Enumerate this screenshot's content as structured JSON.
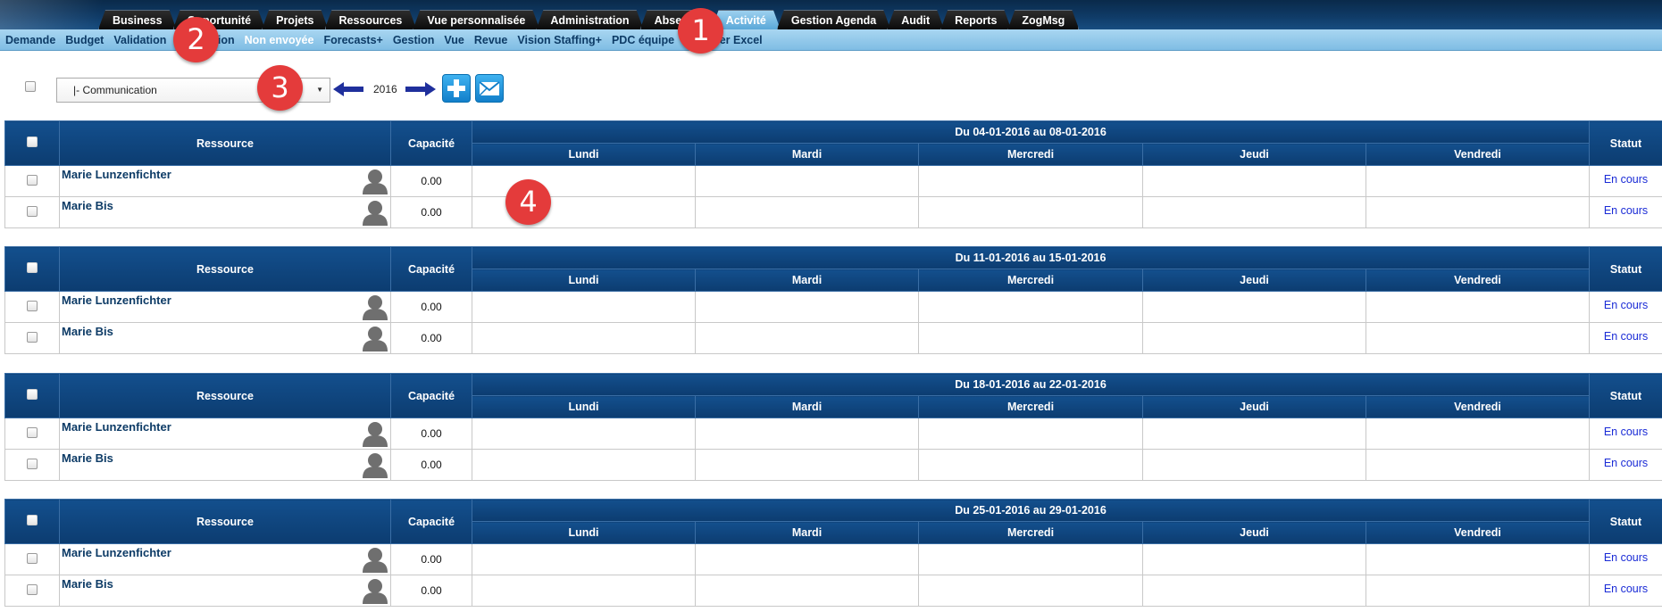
{
  "tabs": [
    {
      "label": "Business",
      "active": false
    },
    {
      "label": "Opportunité",
      "active": false
    },
    {
      "label": "Projets",
      "active": false
    },
    {
      "label": "Ressources",
      "active": false
    },
    {
      "label": "Vue personnalisée",
      "active": false
    },
    {
      "label": "Administration",
      "active": false
    },
    {
      "label": "Absence",
      "active": false
    },
    {
      "label": "Activité",
      "active": true
    },
    {
      "label": "Gestion Agenda",
      "active": false
    },
    {
      "label": "Audit",
      "active": false
    },
    {
      "label": "Reports",
      "active": false
    },
    {
      "label": "ZogMsg",
      "active": false
    }
  ],
  "submenu": [
    {
      "label": "Demande",
      "active": false
    },
    {
      "label": "Budget",
      "active": false
    },
    {
      "label": "Validation",
      "active": false
    },
    {
      "label": "Annulation",
      "active": false
    },
    {
      "label": "Non envoyée",
      "active": true
    },
    {
      "label": "Forecasts+",
      "active": false
    },
    {
      "label": "Gestion",
      "active": false
    },
    {
      "label": "Vue",
      "active": false
    },
    {
      "label": "Revue",
      "active": false
    },
    {
      "label": "Vision Staffing+",
      "active": false
    },
    {
      "label": "PDC équipe",
      "active": false
    },
    {
      "label": "Exporter Excel",
      "active": false
    }
  ],
  "toolbar": {
    "select_value": "|- Communication",
    "year": "2016",
    "prev_icon": "arrow-left-icon",
    "next_icon": "arrow-right-icon",
    "add_icon": "plus-icon",
    "mail_icon": "envelope-icon"
  },
  "table_headers": {
    "resource": "Ressource",
    "capacity": "Capacité",
    "days": [
      "Lundi",
      "Mardi",
      "Mercredi",
      "Jeudi",
      "Vendredi"
    ],
    "status": "Statut"
  },
  "weeks": [
    {
      "range": "Du 04-01-2016 au 08-01-2016",
      "rows": [
        {
          "name": "Marie Lunzenfichter",
          "capacity": "0.00",
          "status": "En cours"
        },
        {
          "name": "Marie Bis",
          "capacity": "0.00",
          "status": "En cours"
        }
      ]
    },
    {
      "range": "Du 11-01-2016 au 15-01-2016",
      "rows": [
        {
          "name": "Marie Lunzenfichter",
          "capacity": "0.00",
          "status": "En cours"
        },
        {
          "name": "Marie Bis",
          "capacity": "0.00",
          "status": "En cours"
        }
      ]
    },
    {
      "range": "Du 18-01-2016 au 22-01-2016",
      "rows": [
        {
          "name": "Marie Lunzenfichter",
          "capacity": "0.00",
          "status": "En cours"
        },
        {
          "name": "Marie Bis",
          "capacity": "0.00",
          "status": "En cours"
        }
      ]
    },
    {
      "range": "Du 25-01-2016 au 29-01-2016",
      "rows": [
        {
          "name": "Marie Lunzenfichter",
          "capacity": "0.00",
          "status": "En cours"
        },
        {
          "name": "Marie Bis",
          "capacity": "0.00",
          "status": "En cours"
        }
      ]
    }
  ],
  "markers": [
    "1",
    "2",
    "3",
    "4"
  ],
  "colors": {
    "header_blue": "#0c3c70",
    "submenu_blue": "#7fbde4",
    "active_tab": "#5aa8d8",
    "link_blue": "#0d3b66",
    "status_blue": "#1a2bd6",
    "marker_red": "#e43b3b"
  }
}
